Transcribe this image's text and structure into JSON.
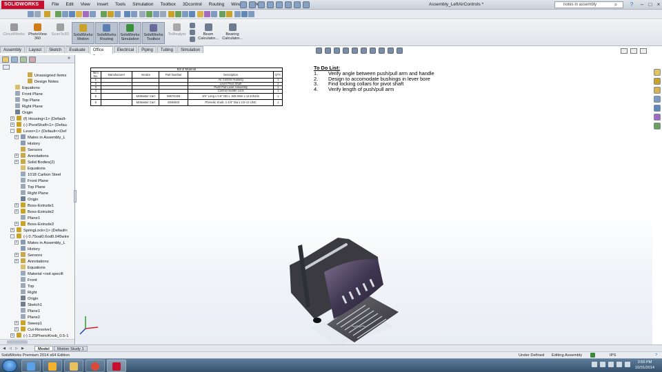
{
  "app": {
    "brand": "SOLIDWORKS",
    "document_title": "Assembly_LeftAirControls *"
  },
  "menu": [
    "File",
    "Edit",
    "View",
    "Insert",
    "Tools",
    "Simulation",
    "Toolbox",
    "3Dcontrol",
    "Routing",
    "Window",
    "Help"
  ],
  "search": {
    "placeholder": "notes in assembly"
  },
  "command_manager": [
    {
      "label": "CircuitWorks",
      "state": "disabled",
      "color": "#9a9a9a"
    },
    {
      "label": "PhotoView\n360",
      "state": "normal",
      "color": "#d07a1a"
    },
    {
      "label": "ScanTo3D",
      "state": "disabled",
      "color": "#a0a0a0"
    },
    {
      "label": "SolidWorks\nMotion",
      "state": "active",
      "color": "#c9a227"
    },
    {
      "label": "SolidWorks\nRouting",
      "state": "active",
      "color": "#5a7fb0"
    },
    {
      "label": "SolidWorks\nSimulation",
      "state": "active",
      "color": "#3c8f3c"
    },
    {
      "label": "SolidWorks\nToolbox",
      "state": "active",
      "color": "#6a6a9a"
    },
    {
      "label": "TolAnalyst",
      "state": "disabled",
      "color": "#a9a9a9"
    },
    {
      "label": "Beam\nCalculator...",
      "state": "normal",
      "color": "#6d7d91"
    },
    {
      "label": "Bearing\nCalculator...",
      "state": "normal",
      "color": "#6d7d91"
    }
  ],
  "tabs": [
    "Assembly",
    "Layout",
    "Sketch",
    "Evaluate",
    "Office Products",
    "Electrical",
    "Piping",
    "Tubing",
    "Simulation"
  ],
  "active_tab": "Office Products",
  "feature_tree": [
    {
      "label": "Unassigned Items",
      "icon": "folder-icon",
      "color": "#caa84a"
    },
    {
      "label": "Design Notes",
      "icon": "folder-icon",
      "color": "#caa84a"
    },
    {
      "label": "Equations",
      "icon": "equations-icon",
      "color": "#d8c070"
    },
    {
      "label": "Front Plane",
      "icon": "plane-icon",
      "color": "#9aa8b8"
    },
    {
      "label": "Top Plane",
      "icon": "plane-icon",
      "color": "#9aa8b8"
    },
    {
      "label": "Right Plane",
      "icon": "plane-icon",
      "color": "#9aa8b8"
    },
    {
      "label": "Origin",
      "icon": "origin-icon",
      "color": "#6f7f90"
    },
    {
      "label": "(f) Housing<1> (Default-",
      "icon": "part-icon",
      "color": "#c9a227"
    },
    {
      "label": "(-) PivotShaft<1> (Defau",
      "icon": "part-icon",
      "color": "#c9a227"
    },
    {
      "label": "Lever<1> (Default<<Def",
      "icon": "part-icon",
      "color": "#c9a227"
    },
    {
      "label": "Mates in Assembly_L",
      "icon": "mates-icon",
      "color": "#8a9ab0"
    },
    {
      "label": "History",
      "icon": "history-icon",
      "color": "#8a9ab0"
    },
    {
      "label": "Sensors",
      "icon": "sensors-icon",
      "color": "#caa84a"
    },
    {
      "label": "Annotations",
      "icon": "annotations-icon",
      "color": "#caa84a"
    },
    {
      "label": "Solid Bodies(2)",
      "icon": "solid-bodies-icon",
      "color": "#caa84a"
    },
    {
      "label": "Equations",
      "icon": "equations-icon",
      "color": "#d8c070"
    },
    {
      "label": "1018 Carbon Steel",
      "icon": "material-icon",
      "color": "#9aa8b8"
    },
    {
      "label": "Front Plane",
      "icon": "plane-icon",
      "color": "#9aa8b8"
    },
    {
      "label": "Top Plane",
      "icon": "plane-icon",
      "color": "#9aa8b8"
    },
    {
      "label": "Right Plane",
      "icon": "plane-icon",
      "color": "#9aa8b8"
    },
    {
      "label": "Origin",
      "icon": "origin-icon",
      "color": "#6f7f90"
    },
    {
      "label": "Boss-Extrude1",
      "icon": "extrude-icon",
      "color": "#c9a227"
    },
    {
      "label": "Boss-Extrude2",
      "icon": "extrude-icon",
      "color": "#c9a227"
    },
    {
      "label": "Plane1",
      "icon": "plane-icon",
      "color": "#9aa8b8"
    },
    {
      "label": "Boss-Extrude3",
      "icon": "extrude-icon",
      "color": "#c9a227"
    },
    {
      "label": "SpringLock<1> (Default<",
      "icon": "part-icon",
      "color": "#c9a227"
    },
    {
      "label": "(-) 0.75oal0.6od0.045wire",
      "icon": "part-icon",
      "color": "#c9a227"
    },
    {
      "label": "Mates in Assembly_L",
      "icon": "mates-icon",
      "color": "#8a9ab0"
    },
    {
      "label": "History",
      "icon": "history-icon",
      "color": "#8a9ab0"
    },
    {
      "label": "Sensors",
      "icon": "sensors-icon",
      "color": "#caa84a"
    },
    {
      "label": "Annotations",
      "icon": "annotations-icon",
      "color": "#caa84a"
    },
    {
      "label": "Equations",
      "icon": "equations-icon",
      "color": "#d8c070"
    },
    {
      "label": "Material <not specifi",
      "icon": "material-icon",
      "color": "#9aa8b8"
    },
    {
      "label": "Front",
      "icon": "plane-icon",
      "color": "#9aa8b8"
    },
    {
      "label": "Top",
      "icon": "plane-icon",
      "color": "#9aa8b8"
    },
    {
      "label": "Right",
      "icon": "plane-icon",
      "color": "#9aa8b8"
    },
    {
      "label": "Origin",
      "icon": "origin-icon",
      "color": "#6f7f90"
    },
    {
      "label": "Sketch1",
      "icon": "sketch-icon",
      "color": "#6f7f90"
    },
    {
      "label": "Plane1",
      "icon": "plane-icon",
      "color": "#9aa8b8"
    },
    {
      "label": "Plane2",
      "icon": "plane-icon",
      "color": "#9aa8b8"
    },
    {
      "label": "Sweep1",
      "icon": "sweep-icon",
      "color": "#c9a227"
    },
    {
      "label": "Cut-Revolve1",
      "icon": "cut-icon",
      "color": "#c9a227"
    },
    {
      "label": "(-) 1.25PhenoKnob_0.5-1",
      "icon": "part-icon",
      "color": "#c9a227"
    }
  ],
  "bom": {
    "title": "Bill of Material",
    "headers": [
      "Item No.",
      "Manufacturer",
      "Vendor",
      "Part Number",
      "Description",
      "QTY."
    ],
    "rows": [
      [
        "1",
        "",
        "",
        "",
        "Air Control Housing",
        "1"
      ],
      [
        "2",
        "",
        "",
        "",
        "Lever Pivot Shaft",
        "1"
      ],
      [
        "3",
        "",
        "",
        "",
        "Push Pull Lever Assembly",
        "1"
      ],
      [
        "4",
        "",
        "",
        "",
        "Control Handle Lock",
        "1"
      ],
      [
        "5",
        "",
        "McMaster Carr",
        "9657K293",
        "3/4\" Long x 0.6\" OD x .045 Wire x 14.5 lbs/in",
        "1"
      ],
      [
        "6",
        "",
        "McMaster Carr",
        "6046K63",
        "Phenolic Knob, 1-1/4\" Dia x 1/2-13 UNC",
        "1"
      ]
    ]
  },
  "todo": {
    "title": "To Do List:",
    "items": [
      {
        "num": "1.",
        "text": "Verify angle between push/pull arm and handle"
      },
      {
        "num": "2.",
        "text": "Design to accomodate bushings in lever bore"
      },
      {
        "num": "3.",
        "text": "Find locking collars for pivot shaft"
      },
      {
        "num": "4.",
        "text": "Verify length of push/pull arm"
      }
    ]
  },
  "bottom_tabs": [
    "Model",
    "Motion Study 1"
  ],
  "status": {
    "edition": "SolidWorks Premium 2014 x64 Edition",
    "state": "Under Defined",
    "mode": "Editing Assembly",
    "units": "IPS",
    "help": "?"
  },
  "clock": {
    "time": "3:55 PM",
    "date": "10/31/2014"
  }
}
